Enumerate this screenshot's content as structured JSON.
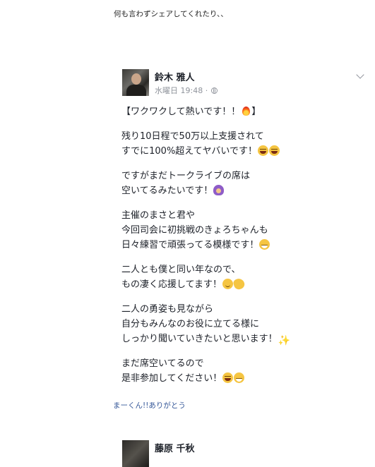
{
  "intro_text": "何も言わずシェアしてくれたり、、",
  "post": {
    "author": "鈴木 雅人",
    "timestamp": "水曜日 19:48 ·",
    "paragraphs": [
      [
        {
          "text": "【ワクワクして熱いです！！",
          "emoji": "fire",
          "after": "】"
        }
      ],
      [
        {
          "text": "残り10日程で50万以上支援されて"
        },
        {
          "text": "すでに100%超えてヤバいです！",
          "emoji": "laugh",
          "emoji2": "laugh"
        }
      ],
      [
        {
          "text": "ですがまだトークライブの席は"
        },
        {
          "text": "空いてるみたいです！",
          "emoji": "ok"
        }
      ],
      [
        {
          "text": "主催のまさと君や"
        },
        {
          "text": "今回司会に初挑戦のきょろちゃんも"
        },
        {
          "text": "日々練習で頑張ってる模様です！",
          "emoji": "grin"
        }
      ],
      [
        {
          "text": "二人とも僕と同い年なので、"
        },
        {
          "text": "もの凄く応援してます！",
          "emoji": "smile",
          "emoji2": "clap"
        }
      ],
      [
        {
          "text": "二人の勇姿も見ながら"
        },
        {
          "text": "自分もみんなのお役に立てる様に"
        },
        {
          "text": "しっかり聞いていきたいと思います！",
          "emoji": "spark"
        }
      ],
      [
        {
          "text": "まだ席空いてるので"
        },
        {
          "text": "是非参加してください！",
          "emoji": "laugh",
          "emoji2": "grin"
        }
      ]
    ]
  },
  "reply_text": "まーくん!!ありがとう",
  "next_post": {
    "author": "藤原 千秋"
  },
  "icons": {
    "globe": "globe-icon",
    "dropdown": "chevron-down-icon"
  },
  "colors": {
    "link": "#365899",
    "meta": "#90949c",
    "text": "#1d2129"
  }
}
